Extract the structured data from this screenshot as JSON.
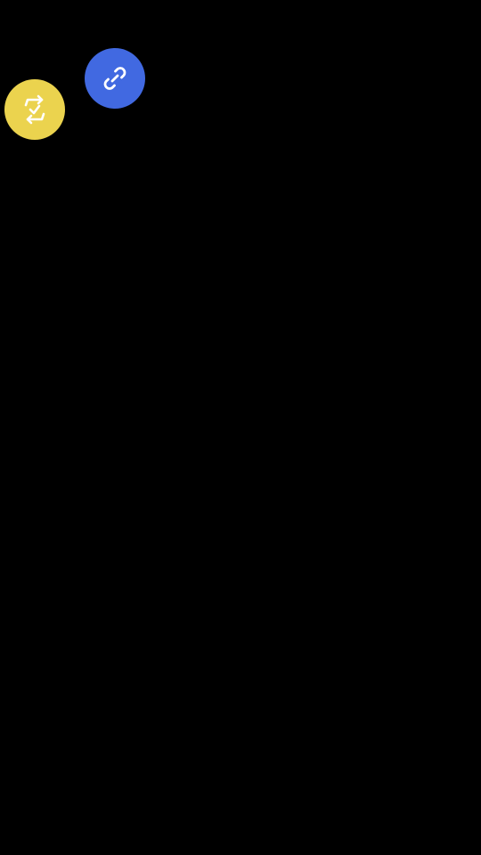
{
  "screen": {
    "background": "#000000"
  },
  "buttons": {
    "sync": {
      "icon": "sync-check-icon",
      "color": "#EBD34E",
      "icon_color": "#FFFFFF"
    },
    "link": {
      "icon": "link-icon",
      "color": "#4169E1",
      "icon_color": "#FFFFFF"
    }
  }
}
